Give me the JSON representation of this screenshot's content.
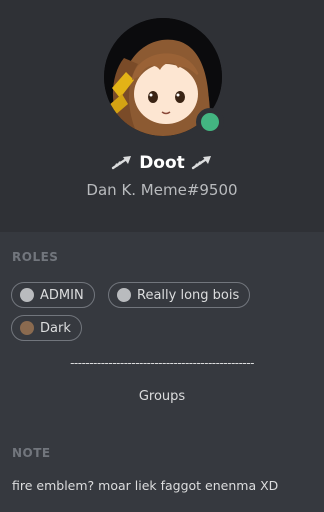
{
  "profile": {
    "display_name": "Doot",
    "tag": "Dan K. Meme#9500",
    "status": "online",
    "status_color": "#43b581",
    "name_decoration_icon": "trumpet-icon"
  },
  "roles": {
    "title": "ROLES",
    "items": [
      {
        "label": "ADMIN",
        "color": "#b9bbbe"
      },
      {
        "label": "Really long bois",
        "color": "#b9bbbe"
      },
      {
        "label": "Dark",
        "color": "#8a6a4f"
      }
    ]
  },
  "groups": {
    "divider": "------------------------------------------------",
    "label": "Groups"
  },
  "note": {
    "title": "NOTE",
    "text": "fire emblem? moar liek faggot enenma XD"
  }
}
